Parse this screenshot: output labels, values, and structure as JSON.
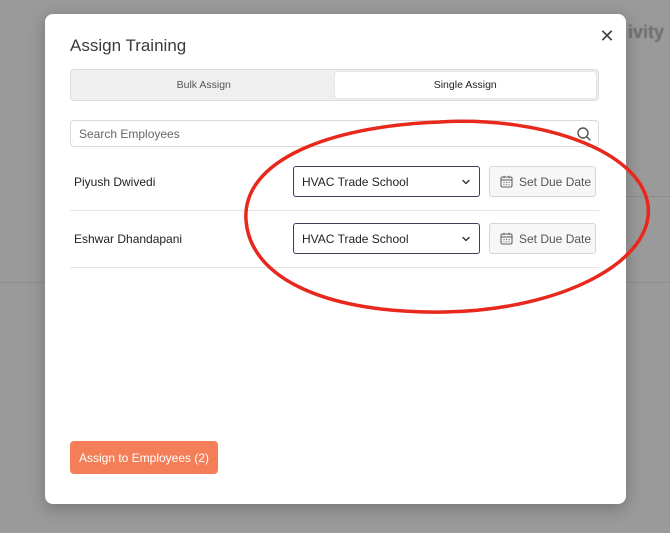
{
  "background": {
    "heading": "ivity"
  },
  "modal": {
    "title": "Assign Training",
    "close_symbol": "✕",
    "tabs": [
      {
        "label": "Bulk Assign",
        "active": false
      },
      {
        "label": "Single Assign",
        "active": true
      }
    ],
    "search": {
      "placeholder": "Search Employees",
      "value": ""
    },
    "employees": [
      {
        "name": "Piyush Dwivedi",
        "training": "HVAC Trade School",
        "due_date_label": "Set Due Date"
      },
      {
        "name": "Eshwar Dhandapani",
        "training": "HVAC Trade School",
        "due_date_label": "Set Due Date"
      }
    ],
    "assign_button_label": "Assign to Employees (2)"
  },
  "colors": {
    "accent": "#f47e57",
    "annotation": "#e8281c",
    "select_border": "#3a3f5c"
  }
}
